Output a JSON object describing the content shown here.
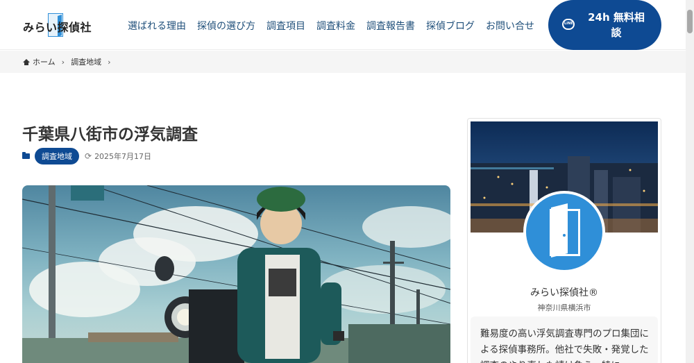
{
  "header": {
    "logo_text": "みらい探偵社",
    "nav": [
      {
        "label": "選ばれる理由"
      },
      {
        "label": "探偵の選び方"
      },
      {
        "label": "調査項目"
      },
      {
        "label": "調査料金"
      },
      {
        "label": "調査報告書"
      },
      {
        "label": "探偵ブログ"
      },
      {
        "label": "お問い合せ"
      }
    ],
    "cta_line1": "24h 無料相",
    "cta_line2": "談",
    "cta_icon": "line-icon"
  },
  "breadcrumb": {
    "home": "ホーム",
    "category": "調査地域"
  },
  "article": {
    "title": "千葉県八街市の浮気調査",
    "category_badge": "調査地域",
    "date": "2025年7月17日"
  },
  "sidebar": {
    "name": "みらい探偵社®",
    "location": "神奈川県横浜市",
    "description": "難易度の高い浮気調査専門のプロ集団による探偵事務所。他社で失敗・発覚した調査のやり直しも請け負う。特に"
  },
  "colors": {
    "brand_navy": "#0e4a93",
    "logo_blue": "#2f8fd8",
    "nav_text": "#1f4f7a"
  }
}
